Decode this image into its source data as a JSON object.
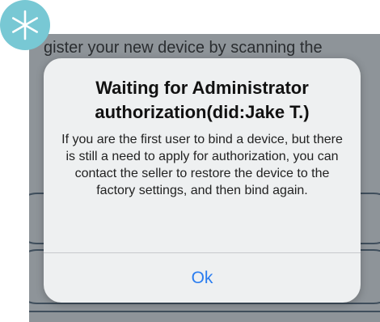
{
  "background_screen": {
    "header_text": "gister your new device by scanning the"
  },
  "dialog": {
    "title": "Waiting for Administrator authorization(did:Jake T.)",
    "message": "If you are the first user to bind a device, but there is still a need to apply for authorization, you can contact the seller to restore the device to the factory settings, and then bind again.",
    "ok_label": "Ok"
  },
  "colors": {
    "accent": "#2a7df0",
    "badge": "#78c8d4",
    "overlay": "#8e9499",
    "dialog_bg": "#eef0f1"
  },
  "icons": {
    "corner": "asterisk-icon"
  }
}
